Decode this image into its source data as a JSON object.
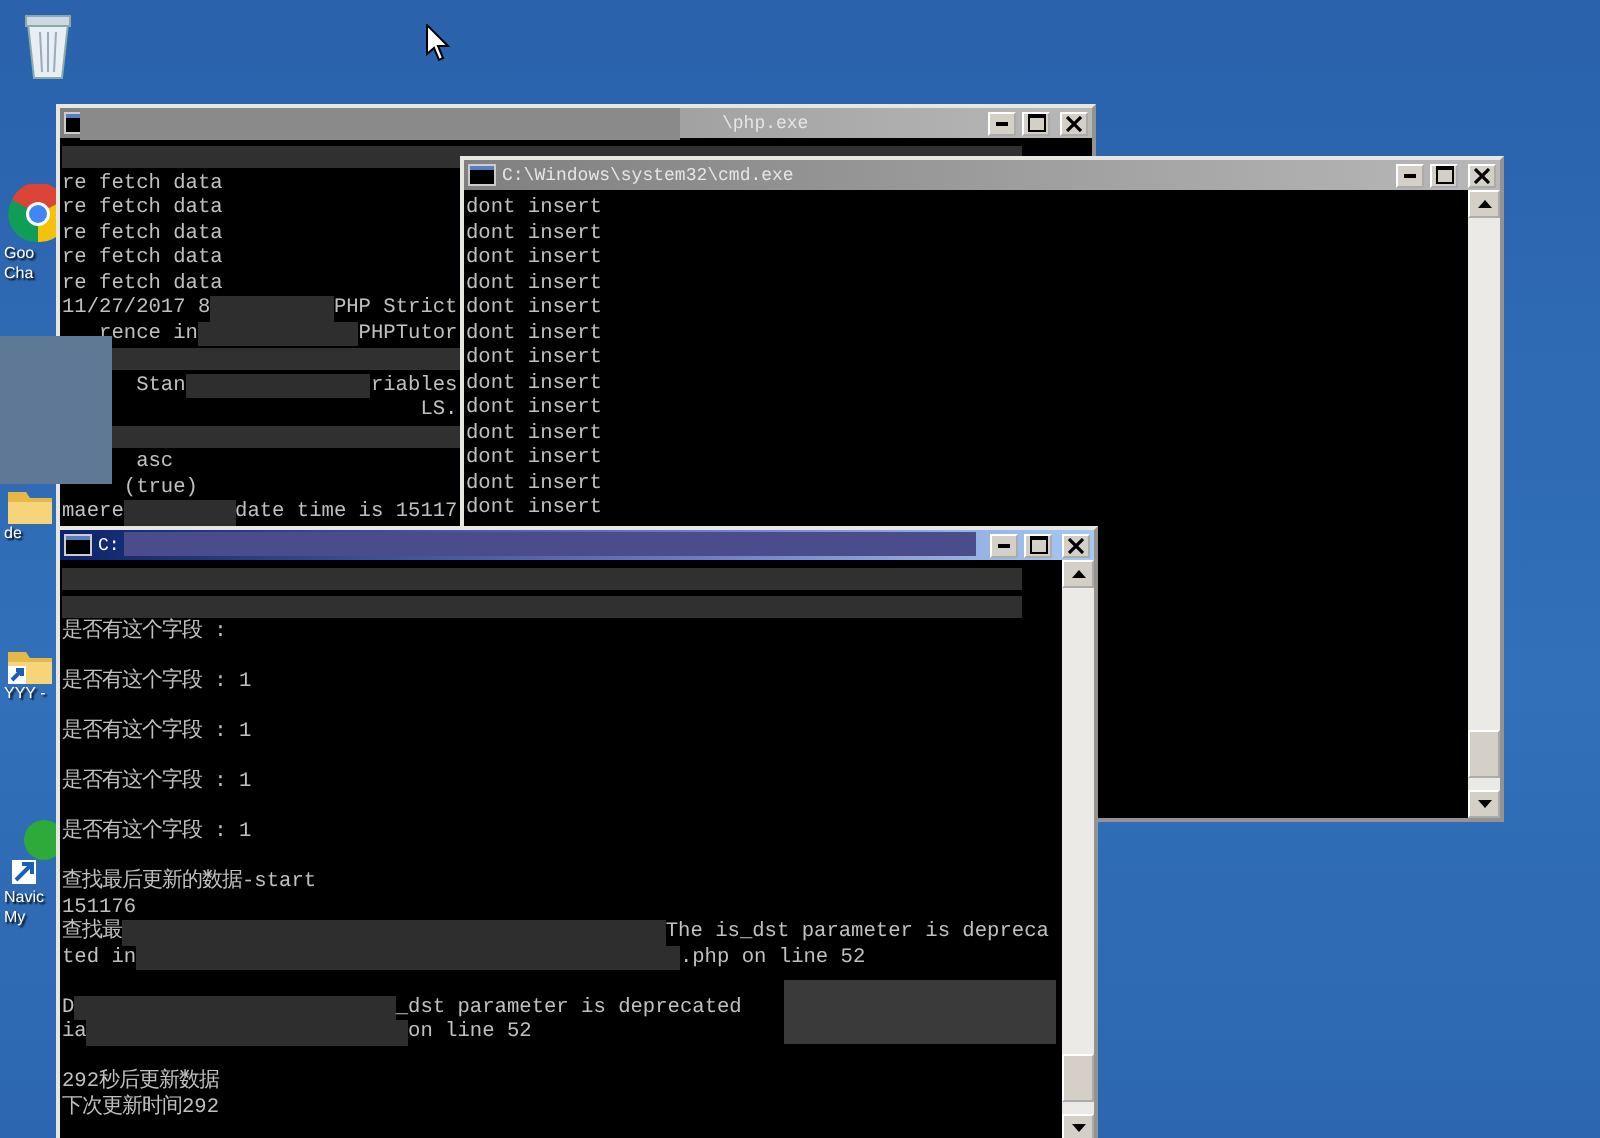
{
  "desktop": {
    "icons": [
      {
        "kind": "recycle-bin"
      },
      {
        "kind": "browser",
        "labels": [
          "Goo",
          "Cha"
        ]
      },
      {
        "kind": "folder",
        "labels": [
          "de"
        ]
      },
      {
        "kind": "folder-shortcut",
        "labels": [
          "YYY -"
        ]
      },
      {
        "kind": "app-shortcut",
        "labels": [
          "Navic",
          "My"
        ]
      }
    ]
  },
  "windows": [
    {
      "title": "\\php.exe",
      "active": false,
      "scrollbar": false,
      "lines": [
        {
          "kind": "redacted"
        },
        {
          "kind": "text",
          "text": "re fetch data"
        },
        {
          "kind": "text",
          "text": "re fetch data"
        },
        {
          "kind": "text",
          "text": "re fetch data"
        },
        {
          "kind": "text",
          "text": "re fetch data"
        },
        {
          "kind": "text",
          "text": "re fetch data"
        },
        {
          "kind": "text",
          "text": "11/27/2017 8          PHP Strict"
        },
        {
          "kind": "text",
          "text": "   rence in             PHPTutor"
        },
        {
          "kind": "redacted"
        },
        {
          "kind": "text",
          "text": "      Stan               riables"
        },
        {
          "kind": "text",
          "text": "                             LS."
        },
        {
          "kind": "redacted"
        },
        {
          "kind": "text",
          "text": "      asc"
        },
        {
          "kind": "text",
          "text": "     (true)"
        },
        {
          "kind": "text",
          "text": "maere         date time is 15117"
        }
      ]
    },
    {
      "title": "C:\\Windows\\system32\\cmd.exe",
      "active": false,
      "scrollbar": true,
      "lines": [
        {
          "kind": "text",
          "text": "dont insert"
        },
        {
          "kind": "text",
          "text": "dont insert"
        },
        {
          "kind": "text",
          "text": "dont insert"
        },
        {
          "kind": "text",
          "text": "dont insert"
        },
        {
          "kind": "text",
          "text": "dont insert"
        },
        {
          "kind": "text",
          "text": "dont insert"
        },
        {
          "kind": "text",
          "text": "dont insert"
        },
        {
          "kind": "text",
          "text": "dont insert"
        },
        {
          "kind": "text",
          "text": "dont insert"
        },
        {
          "kind": "text",
          "text": "dont insert"
        },
        {
          "kind": "text",
          "text": "dont insert"
        },
        {
          "kind": "text",
          "text": "dont insert"
        },
        {
          "kind": "text",
          "text": "dont insert"
        }
      ]
    },
    {
      "title": "C:",
      "active": true,
      "scrollbar": true,
      "lines": [
        {
          "kind": "redacted"
        },
        {
          "kind": "redacted"
        },
        {
          "kind": "text",
          "text": "是否有这个字段 :"
        },
        {
          "kind": "blank"
        },
        {
          "kind": "text",
          "text": "是否有这个字段 : 1"
        },
        {
          "kind": "blank"
        },
        {
          "kind": "text",
          "text": "是否有这个字段 : 1"
        },
        {
          "kind": "blank"
        },
        {
          "kind": "text",
          "text": "是否有这个字段 : 1"
        },
        {
          "kind": "blank"
        },
        {
          "kind": "text",
          "text": "是否有这个字段 : 1"
        },
        {
          "kind": "blank"
        },
        {
          "kind": "text",
          "text": "查找最后更新的数据-start"
        },
        {
          "kind": "text",
          "text": "151176"
        },
        {
          "kind": "text",
          "text": "查找最                                            The is_dst parameter is depreca"
        },
        {
          "kind": "text",
          "text": "ted in                                            .php on line 52"
        },
        {
          "kind": "blank"
        },
        {
          "kind": "text",
          "text": "D                          _dst parameter is deprecated"
        },
        {
          "kind": "text",
          "text": "ia                          on line 52"
        },
        {
          "kind": "blank"
        },
        {
          "kind": "text",
          "text": "292秒后更新数据"
        },
        {
          "kind": "text",
          "text": "下次更新时间292"
        }
      ]
    }
  ]
}
